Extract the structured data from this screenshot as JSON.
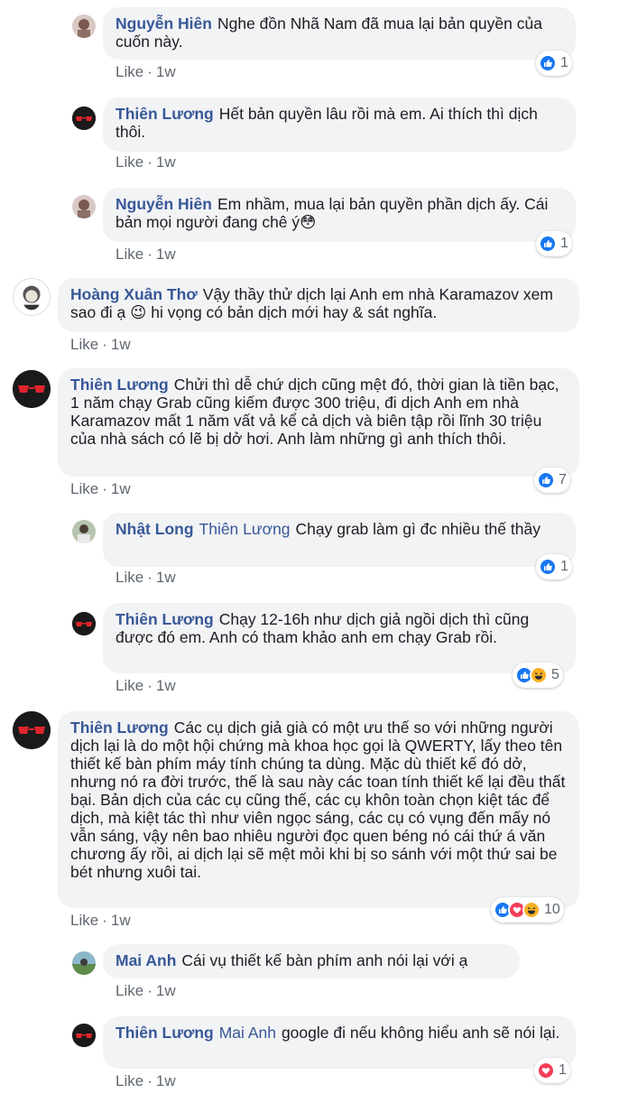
{
  "comments": [
    {
      "name": "Nguyễn Hiên",
      "tag": "",
      "text": "Nghe đồn Nhã Nam đã mua lại bản quyền của cuốn này.",
      "like": "Like",
      "time": "1w",
      "reactions": "1"
    },
    {
      "name": "Thiên Lương",
      "tag": "",
      "text": "Hết bản quyền lâu rồi mà em. Ai thích thì dịch thôi.",
      "like": "Like",
      "time": "1w",
      "reactions": ""
    },
    {
      "name": "Nguyễn Hiên",
      "tag": "",
      "text": "Em nhầm, mua lại bản quyền phần dịch ấy. Cái bản mọi người đang chê ý😳",
      "like": "Like",
      "time": "1w",
      "reactions": "1"
    },
    {
      "name": "Hoàng Xuân Thơ",
      "tag": "",
      "text": "Vậy thầy thử dịch lại Anh em nhà Karamazov xem sao đi ạ 😉 hi vọng có bản dịch mới hay & sát nghĩa.",
      "like": "Like",
      "time": "1w",
      "reactions": ""
    },
    {
      "name": "Thiên Lương",
      "tag": "",
      "text": "Chửi thì dễ chứ dịch cũng mệt đó, thời gian là tiền bạc, 1 năm chạy Grab cũng kiếm được 300 triệu, đi dịch Anh em nhà Karamazov mất 1 năm vất vả kể cả dịch và biên tập rồi lĩnh 30 triệu của nhà sách có lẽ bị dở hơi. Anh làm những gì anh thích thôi.",
      "like": "Like",
      "time": "1w",
      "reactions": "7"
    },
    {
      "name": "Nhật Long",
      "tag": "Thiên Lương",
      "text": "Chạy grab làm gì đc nhiều thế thầy",
      "like": "Like",
      "time": "1w",
      "reactions": "1"
    },
    {
      "name": "Thiên Lương",
      "tag": "",
      "text": "Chạy 12-16h như dịch giả ngồi dịch thì cũng được đó em. Anh có tham khảo anh em chạy Grab rồi.",
      "like": "Like",
      "time": "1w",
      "reactions": "5"
    },
    {
      "name": "Thiên Lương",
      "tag": "",
      "text": "Các cụ dịch giả già có một ưu thế so với những người dịch lại là do một hội chứng mà khoa học gọi là QWERTY, lấy theo tên thiết kế bàn phím máy tính chúng ta dùng. Mặc dù thiết kế đó dở, nhưng nó ra đời trước, thế là sau này các toan tính thiết kế lại đều thất bại. Bản dịch của các cụ cũng thế, các cụ khôn toàn chọn kiệt tác để dịch, mà kiệt tác thì như viên ngọc sáng, các cụ có vụng đến mấy nó vẫn sáng, vậy nên bao nhiêu người đọc quen béng nó cái thứ á văn chương ấy rồi, ai dịch lại sẽ mệt mỏi khi bị so sánh với một thứ sai be bét nhưng xuôi tai.",
      "like": "Like",
      "time": "1w",
      "reactions": "10"
    },
    {
      "name": "Mai Anh",
      "tag": "",
      "text": "Cái vụ thiết kế bàn phím anh nói lại với ạ",
      "like": "Like",
      "time": "1w",
      "reactions": ""
    },
    {
      "name": "Thiên Lương",
      "tag": "Mai Anh",
      "text": "google đi nếu không hiểu anh sẽ nói lại.",
      "like": "Like",
      "time": "1w",
      "reactions": "1"
    }
  ],
  "colors": {
    "link": "#385898",
    "bubble": "#f2f3f5",
    "like_blue": "#1877f2",
    "love_red": "#f33e58",
    "haha_yellow": "#f7b125"
  },
  "icons": {
    "like": "thumbs-up-icon",
    "love": "heart-icon",
    "haha": "laughing-face-icon"
  }
}
